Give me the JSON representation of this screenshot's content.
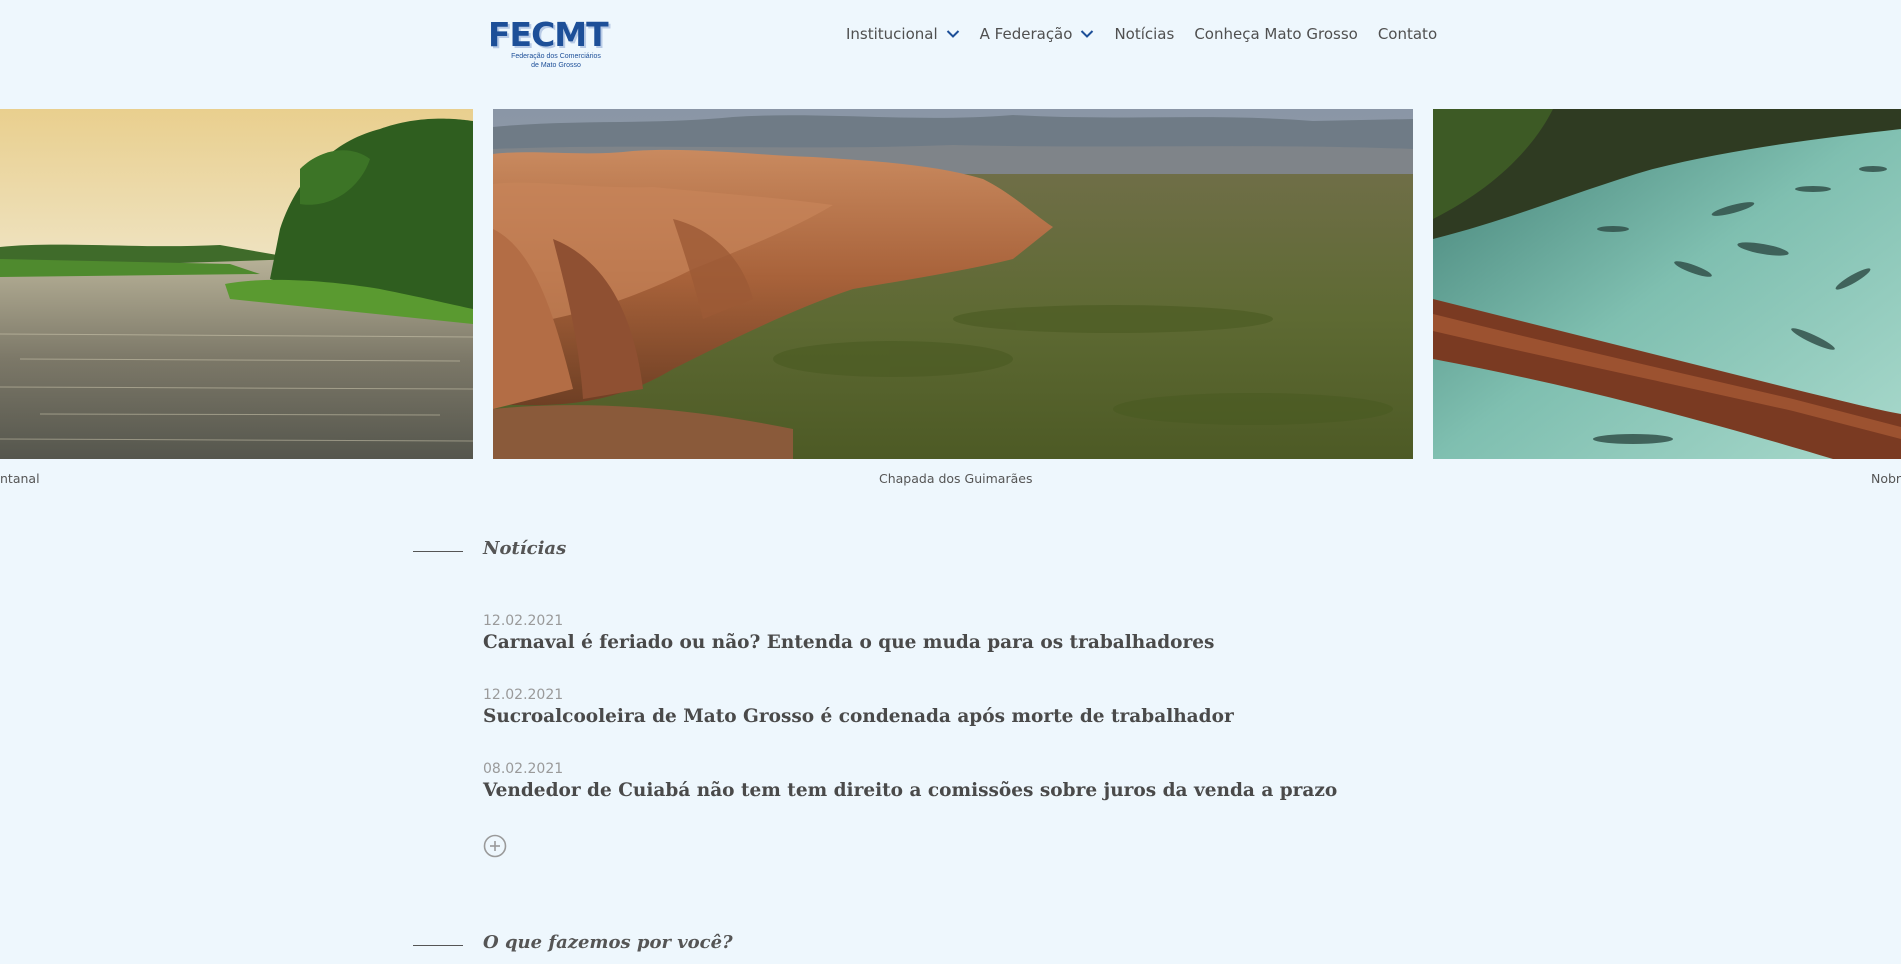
{
  "brand": {
    "logo_text": "FECMT",
    "logo_subtitle_line1": "Federação dos Comerciários",
    "logo_subtitle_line2": "de Mato Grosso"
  },
  "nav": {
    "items": [
      {
        "label": "Institucional",
        "has_dropdown": true
      },
      {
        "label": "A Federação",
        "has_dropdown": true
      },
      {
        "label": "Notícias",
        "has_dropdown": false
      },
      {
        "label": "Conheça Mato Grosso",
        "has_dropdown": false
      },
      {
        "label": "Contato",
        "has_dropdown": false
      }
    ]
  },
  "carousel": {
    "slides": [
      {
        "caption": "ntanal",
        "scene": "pantanal-river"
      },
      {
        "caption": "Chapada dos Guimarães",
        "scene": "chapada-cliffs"
      },
      {
        "caption": "Nobr",
        "scene": "clear-water-fish"
      }
    ]
  },
  "news": {
    "heading": "Notícias",
    "items": [
      {
        "date": "12.02.2021",
        "title": "Carnaval é feriado ou não? Entenda o que muda para os trabalhadores"
      },
      {
        "date": "12.02.2021",
        "title": "Sucroalcooleira de Mato Grosso é condenada após morte de trabalhador"
      },
      {
        "date": "08.02.2021",
        "title": "Vendedor de Cuiabá não tem tem direito a comissões sobre juros da venda a prazo"
      }
    ],
    "more_icon": "plus-circle-icon"
  },
  "services": {
    "heading": "O que fazemos por você?"
  },
  "colors": {
    "background": "#eef7fd",
    "brand_blue": "#1d4f98",
    "nav_text": "#505050",
    "date_text": "#9a9a9a"
  }
}
